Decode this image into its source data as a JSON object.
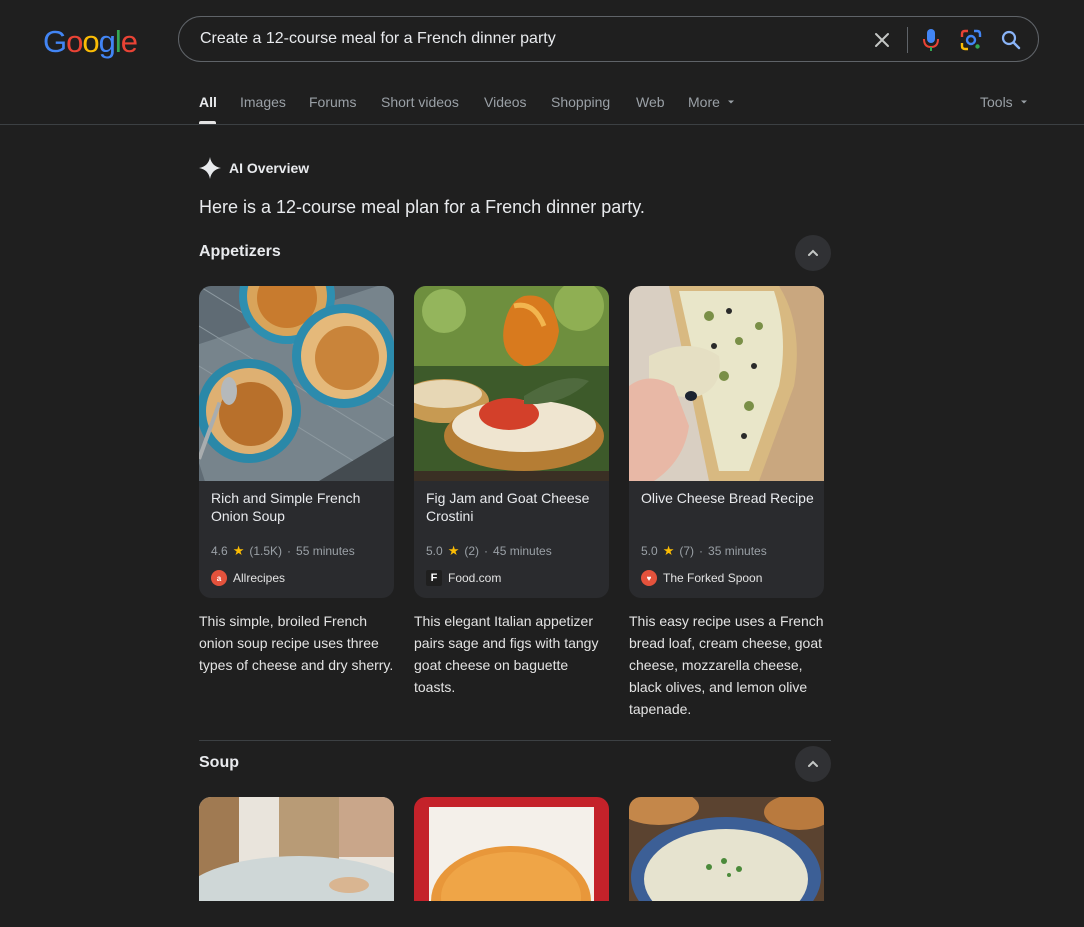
{
  "logo": "Google",
  "search": {
    "query": "Create a 12-course meal for a French dinner party",
    "clear_icon": "close-icon",
    "voice_icon": "mic-icon",
    "lens_icon": "lens-icon",
    "search_icon": "search-icon"
  },
  "tabs": [
    {
      "label": "All",
      "active": true
    },
    {
      "label": "Images"
    },
    {
      "label": "Forums"
    },
    {
      "label": "Short videos"
    },
    {
      "label": "Videos"
    },
    {
      "label": "Shopping"
    },
    {
      "label": "Web"
    },
    {
      "label": "More"
    }
  ],
  "tools_label": "Tools",
  "ai_overview": {
    "label": "AI Overview",
    "intro": "Here is a 12-course meal plan for a French dinner party."
  },
  "sections": [
    {
      "title": "Appetizers",
      "cards": [
        {
          "title": "Rich and Simple French Onion Soup",
          "rating": "4.6",
          "reviews": "(1.5K)",
          "time": "55 minutes",
          "source": "Allrecipes",
          "description": "This simple, broiled French onion soup recipe uses three types of cheese and dry sherry."
        },
        {
          "title": "Fig Jam and Goat Cheese Crostini",
          "rating": "5.0",
          "reviews": "(2)",
          "time": "45 minutes",
          "source": "Food.com",
          "description": "This elegant Italian appetizer pairs sage and figs with tangy goat cheese on baguette toasts."
        },
        {
          "title": "Olive Cheese Bread Recipe",
          "rating": "5.0",
          "reviews": "(7)",
          "time": "35 minutes",
          "source": "The Forked Spoon",
          "description": "This easy recipe uses a French bread loaf, cream cheese, goat cheese, mozzarella cheese, black olives, and lemon olive tapenade."
        }
      ]
    },
    {
      "title": "Soup"
    }
  ],
  "colors": {
    "background": "#1f1f1f",
    "star": "#fbbc04",
    "text": "#e3e3e3"
  }
}
